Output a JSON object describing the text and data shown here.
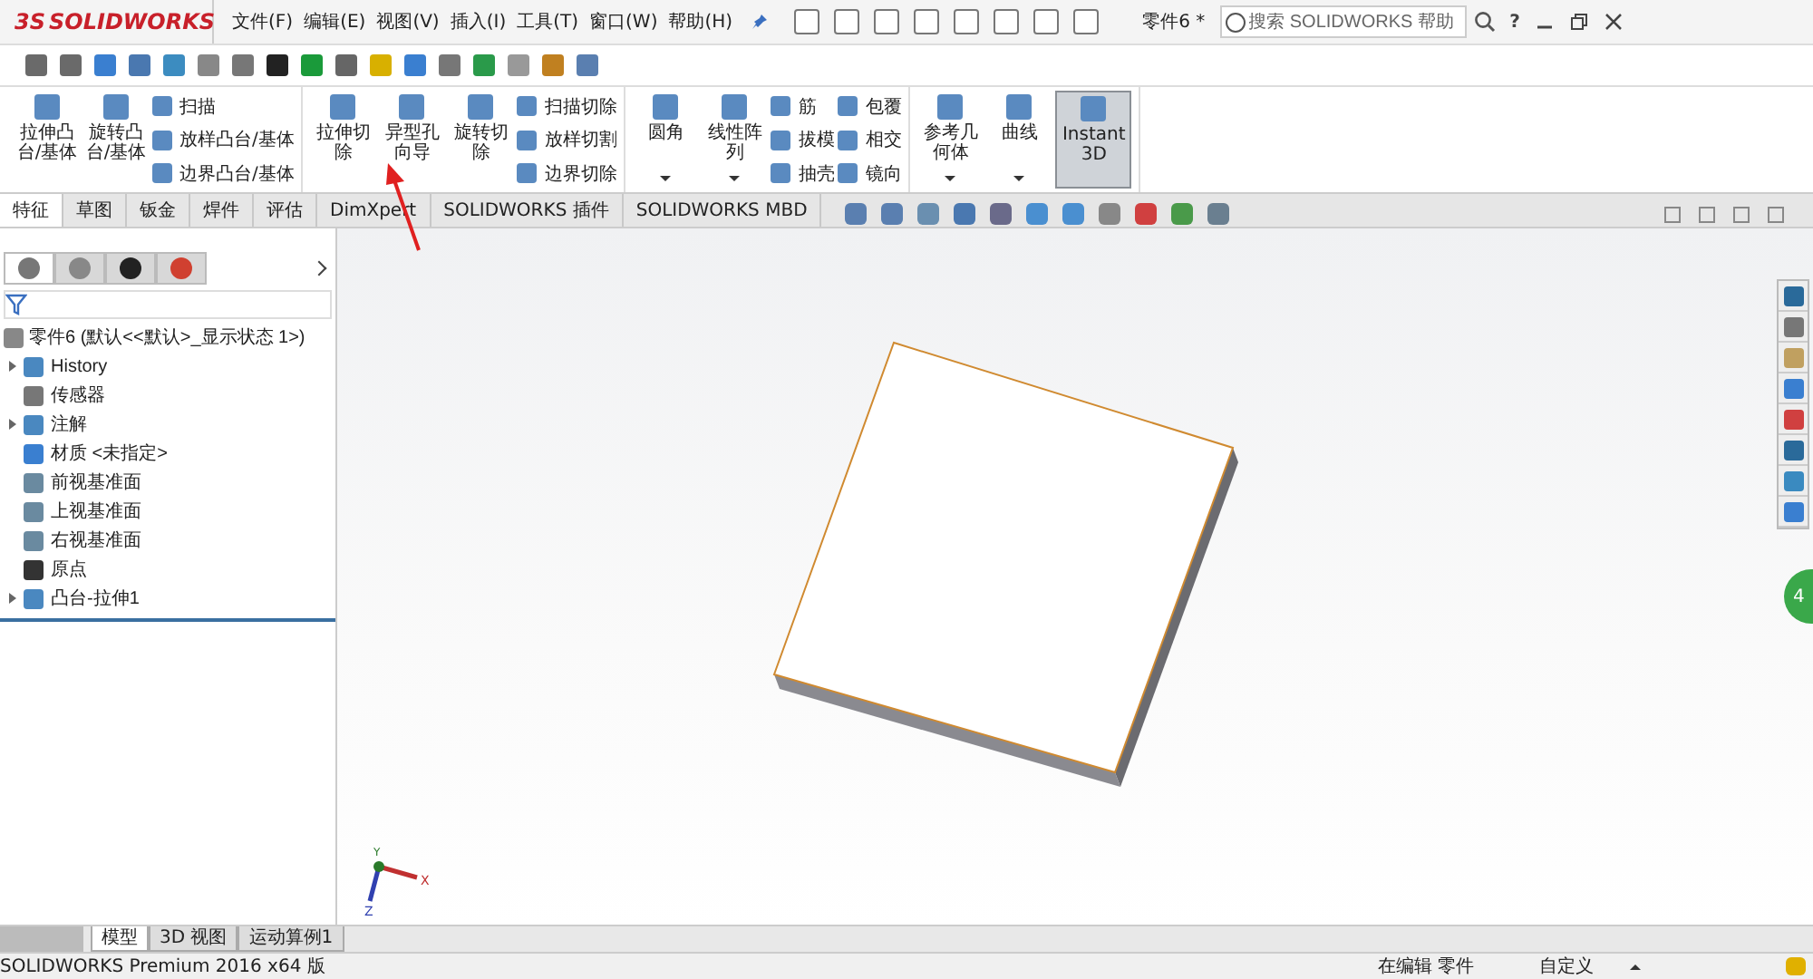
{
  "title_bar": {
    "logo_prefix": "3S",
    "logo": "SOLIDWORKS",
    "menu": [
      "文件(F)",
      "编辑(E)",
      "视图(V)",
      "插入(I)",
      "工具(T)",
      "窗口(W)",
      "帮助(H)"
    ],
    "document_title": "零件6 *",
    "search_placeholder": "搜索 SOLIDWORKS 帮助",
    "help": "?"
  },
  "ribbon": {
    "groups": [
      {
        "commands": [
          {
            "kind": "large",
            "label": "拉伸凸台/基体",
            "dropdown": false,
            "pressed": false
          },
          {
            "kind": "large",
            "label": "旋转凸台/基体",
            "dropdown": false,
            "pressed": false
          },
          {
            "kind": "stack",
            "items": [
              "扫描",
              "放样凸台/基体",
              "边界凸台/基体"
            ]
          }
        ]
      },
      {
        "commands": [
          {
            "kind": "large",
            "label": "拉伸切除",
            "dropdown": false,
            "pressed": false
          },
          {
            "kind": "large",
            "label": "异型孔向导",
            "dropdown": false,
            "pressed": false
          },
          {
            "kind": "large",
            "label": "旋转切除",
            "dropdown": false,
            "pressed": false
          },
          {
            "kind": "stack",
            "items": [
              "扫描切除",
              "放样切割",
              "边界切除"
            ]
          }
        ]
      },
      {
        "commands": [
          {
            "kind": "large",
            "label": "圆角",
            "dropdown": true,
            "pressed": false
          },
          {
            "kind": "large",
            "label": "线性阵列",
            "dropdown": true,
            "pressed": false
          },
          {
            "kind": "stack",
            "items": [
              "筋",
              "拔模",
              "抽壳"
            ]
          },
          {
            "kind": "stack",
            "items": [
              "包覆",
              "相交",
              "镜向"
            ]
          }
        ]
      },
      {
        "commands": [
          {
            "kind": "large",
            "label": "参考几何体",
            "dropdown": true,
            "pressed": false
          },
          {
            "kind": "large",
            "label": "曲线",
            "dropdown": true,
            "pressed": false
          },
          {
            "kind": "wide",
            "label": "Instant3D",
            "dropdown": false,
            "pressed": true
          }
        ]
      }
    ]
  },
  "command_tabs": [
    {
      "label": "特征",
      "selected": true
    },
    {
      "label": "草图",
      "selected": false
    },
    {
      "label": "钣金",
      "selected": false
    },
    {
      "label": "焊件",
      "selected": false
    },
    {
      "label": "评估",
      "selected": false
    },
    {
      "label": "DimXpert",
      "selected": false
    },
    {
      "label": "SOLIDWORKS 插件",
      "selected": false
    },
    {
      "label": "SOLIDWORKS MBD",
      "selected": false
    }
  ],
  "panel_tabs": [
    {
      "kind": "tree",
      "selected": true
    },
    {
      "kind": "property",
      "selected": false
    },
    {
      "kind": "config",
      "selected": false
    },
    {
      "kind": "appearance",
      "selected": false
    }
  ],
  "tree": {
    "root": "零件6 (默认<<默认>_显示状态 1>)",
    "items": [
      {
        "kind": "folder",
        "label": "History",
        "expandable": true
      },
      {
        "kind": "sensor",
        "label": "传感器",
        "expandable": false
      },
      {
        "kind": "annotation",
        "label": "注解",
        "expandable": true
      },
      {
        "kind": "material",
        "label": "材质 <未指定>",
        "expandable": false
      },
      {
        "kind": "plane",
        "label": "前视基准面",
        "expandable": false
      },
      {
        "kind": "plane",
        "label": "上视基准面",
        "expandable": false
      },
      {
        "kind": "plane",
        "label": "右视基准面",
        "expandable": false
      },
      {
        "kind": "origin",
        "label": "原点",
        "expandable": false
      },
      {
        "kind": "feature",
        "label": "凸台-拉伸1",
        "expandable": true
      }
    ]
  },
  "viewport": {
    "triad_labels": [
      "Y",
      "X",
      "Z"
    ],
    "badge": "4"
  },
  "bottom_tabs": [
    {
      "label": "模型",
      "selected": true
    },
    {
      "label": "3D 视图",
      "selected": false
    },
    {
      "label": "运动算例1",
      "selected": false
    }
  ],
  "status_bar": {
    "product": "SOLIDWORKS Premium 2016 x64 版",
    "mode": "在编辑 零件",
    "units": "自定义"
  }
}
